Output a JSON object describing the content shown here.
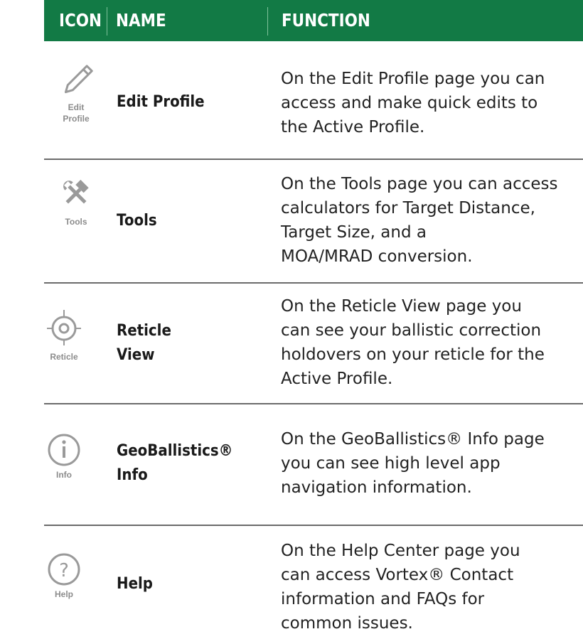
{
  "header": {
    "col_icon": "ICON",
    "col_name": "NAME",
    "col_function": "FUNCTION",
    "background_color": "#127a45"
  },
  "rows": [
    {
      "icon": "pencil-icon",
      "icon_label": "Edit\nProfile",
      "name": "Edit Profile",
      "function": "On the Edit Profile page you can\naccess and make quick edits to\nthe Active Profile."
    },
    {
      "icon": "tools-icon",
      "icon_label": "Tools",
      "name": "Tools",
      "function": "On the Tools page you can access\ncalculators for Target Distance,\nTarget Size, and a\nMOA/MRAD conversion."
    },
    {
      "icon": "reticle-icon",
      "icon_label": "Reticle",
      "name": "Reticle\nView",
      "function": "On the Reticle View page you\ncan see your ballistic correction\nholdovers on your reticle for the\nActive Profile."
    },
    {
      "icon": "info-icon",
      "icon_label": "Info",
      "name": "GeoBallistics®\nInfo",
      "function": "On the GeoBallistics® Info page\nyou can see high level app\nnavigation information."
    },
    {
      "icon": "help-icon",
      "icon_label": "Help",
      "name": "Help",
      "function": "On the Help Center page you\ncan access Vortex® Contact\ninformation and FAQs for\ncommon issues."
    }
  ]
}
